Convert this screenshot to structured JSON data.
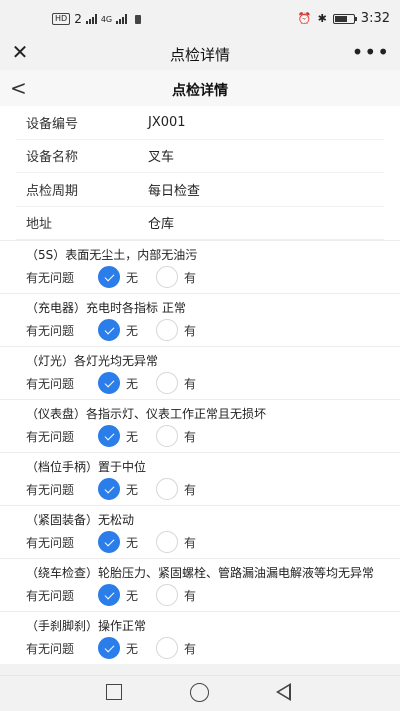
{
  "status_bar": {
    "left_chips": [
      "HD",
      "2"
    ],
    "network": "4G",
    "time": "3:32",
    "icons": [
      "alarm-icon",
      "bluetooth-icon",
      "battery-icon"
    ]
  },
  "titlebar": {
    "title": "点检详情"
  },
  "header": {
    "title": "点检详情"
  },
  "info": [
    {
      "label": "设备编号",
      "value": "JX001"
    },
    {
      "label": "设备名称",
      "value": "叉车"
    },
    {
      "label": "点检周期",
      "value": "每日检查"
    },
    {
      "label": "地址",
      "value": "仓库"
    }
  ],
  "answer_label": "有无问题",
  "option_no": "无",
  "option_yes": "有",
  "items": [
    {
      "question": "（5S）表面无尘土，内部无油污",
      "selected": "无"
    },
    {
      "question": "（充电器）充电时各指标 正常",
      "selected": "无"
    },
    {
      "question": "（灯光）各灯光均无异常",
      "selected": "无"
    },
    {
      "question": "（仪表盘）各指示灯、仪表工作正常且无损坏",
      "selected": "无"
    },
    {
      "question": "（档位手柄）置于中位",
      "selected": "无"
    },
    {
      "question": "（紧固装备）无松动",
      "selected": "无"
    },
    {
      "question": "（绕车检查）轮胎压力、紧固螺栓、管路漏油漏电解液等均无异常",
      "selected": "无"
    },
    {
      "question": "（手刹脚刹）操作正常",
      "selected": "无"
    }
  ],
  "colors": {
    "accent": "#2b7de9",
    "background": "#f2f2f2"
  }
}
